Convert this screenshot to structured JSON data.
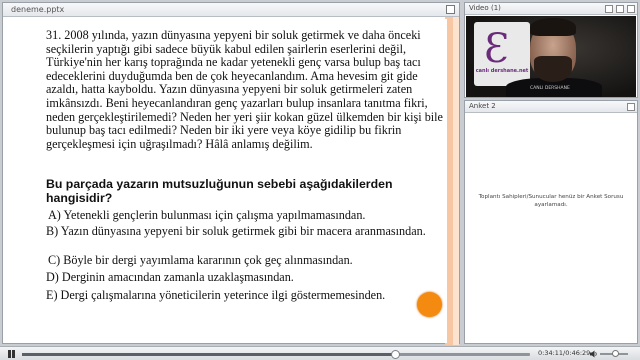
{
  "presentation": {
    "title": "deneme.pptx",
    "question": "31. 2008 yılında, yazın dünyasına yepyeni bir soluk getirmek ve daha önceki seçkilerin yaptığı gibi sadece büyük kabul edilen şairlerin eserlerini değil, Türkiye'nin her karış toprağında ne kadar yetenekli genç varsa bulup baş tacı edeceklerini duyduğumda ben de çok heyecanlandım. Ama hevesim git gide azaldı, hatta kayboldu. Yazın dünyasına yepyeni bir soluk getirmeleri zaten imkânsızdı. Beni heyecanlandıran genç yazarları bulup insanlara tanıtma fikri, neden gerçekleştirilemedi? Neden her yeri şiir kokan güzel ülkemden bir kişi bile bulunup baş tacı edilmedi? Neden bir iki yere veya köye gidilip bu fikrin gerçekleşmesi için uğraşılmadı? Hâlâ anlamış değilim.",
    "prompt": "Bu parçada yazarın mutsuzluğunun sebebi aşağıdakilerden hangisidir?",
    "options": {
      "a": "A) Yetenekli gençlerin bulunması için çalışma yapılmamasından.",
      "b": "B) Yazın dünyasına yepyeni bir soluk getirmek gibi bir macera aranmasından.",
      "c": "C) Böyle bir dergi yayımlama kararının çok geç alınmasından.",
      "d": "D) Derginin amacından zamanla uzaklaşmasından.",
      "e": "E) Dergi çalışmalarına yöneticilerin yeterince ilgi göstermemesinden."
    }
  },
  "video": {
    "title": "Video",
    "count": "(1)",
    "caption": "CANLI DERSHANE",
    "logo_text": "canlı dershane.net"
  },
  "poll": {
    "title": "Anket 2",
    "message": "Toplantı Sahipleri/Sunucular henüz bir Anket Sorusu ayarlamadı."
  },
  "player": {
    "time": "0:34:11/0:46:29",
    "progress": 0.735,
    "volume": 0.45
  },
  "colors": {
    "pointer": "#f58a10",
    "accent_stripe": "#f7c7a4"
  }
}
